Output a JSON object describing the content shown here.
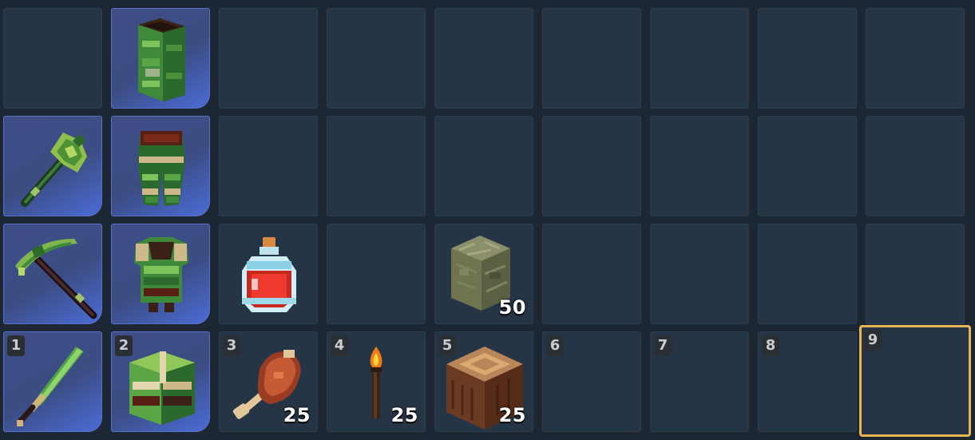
{
  "inventory": {
    "rows": [
      [
        {
          "equipped": false,
          "item": null
        },
        {
          "equipped": true,
          "item": {
            "icon": "jade-helmet-icon"
          }
        },
        {
          "equipped": false,
          "item": null
        },
        {
          "equipped": false,
          "item": null
        },
        {
          "equipped": false,
          "item": null
        },
        {
          "equipped": false,
          "item": null
        },
        {
          "equipped": false,
          "item": null
        },
        {
          "equipped": false,
          "item": null
        },
        {
          "equipped": false,
          "item": null
        }
      ],
      [
        {
          "equipped": true,
          "item": {
            "icon": "jade-axe-icon"
          }
        },
        {
          "equipped": true,
          "item": {
            "icon": "jade-leggings-icon"
          }
        },
        {
          "equipped": false,
          "item": null
        },
        {
          "equipped": false,
          "item": null
        },
        {
          "equipped": false,
          "item": null
        },
        {
          "equipped": false,
          "item": null
        },
        {
          "equipped": false,
          "item": null
        },
        {
          "equipped": false,
          "item": null
        },
        {
          "equipped": false,
          "item": null
        }
      ],
      [
        {
          "equipped": true,
          "item": {
            "icon": "jade-pickaxe-icon"
          }
        },
        {
          "equipped": true,
          "item": {
            "icon": "jade-chestplate-icon"
          }
        },
        {
          "equipped": false,
          "item": {
            "icon": "health-potion-icon"
          }
        },
        {
          "equipped": false,
          "item": null
        },
        {
          "equipped": false,
          "item": {
            "icon": "stone-block-icon",
            "count": "50"
          }
        },
        {
          "equipped": false,
          "item": null
        },
        {
          "equipped": false,
          "item": null
        },
        {
          "equipped": false,
          "item": null
        },
        {
          "equipped": false,
          "item": null
        }
      ]
    ],
    "hotbar": [
      {
        "key": "1",
        "equipped": true,
        "item": {
          "icon": "jade-sword-icon"
        }
      },
      {
        "key": "2",
        "equipped": true,
        "item": {
          "icon": "jade-boots-icon"
        }
      },
      {
        "key": "3",
        "equipped": false,
        "item": {
          "icon": "meat-drumstick-icon",
          "count": "25"
        }
      },
      {
        "key": "4",
        "equipped": false,
        "item": {
          "icon": "torch-icon",
          "count": "25"
        }
      },
      {
        "key": "5",
        "equipped": false,
        "item": {
          "icon": "wood-log-icon",
          "count": "25"
        }
      },
      {
        "key": "6",
        "equipped": false,
        "item": null
      },
      {
        "key": "7",
        "equipped": false,
        "item": null
      },
      {
        "key": "8",
        "equipped": false,
        "item": null
      },
      {
        "key": "9",
        "equipped": false,
        "item": null
      }
    ],
    "selected_hotbar_index": 8,
    "colors": {
      "background": "#1c2733",
      "slot": "#263546",
      "equipped_slot": "#3e4d86",
      "selection_border": "#e6b552"
    }
  }
}
